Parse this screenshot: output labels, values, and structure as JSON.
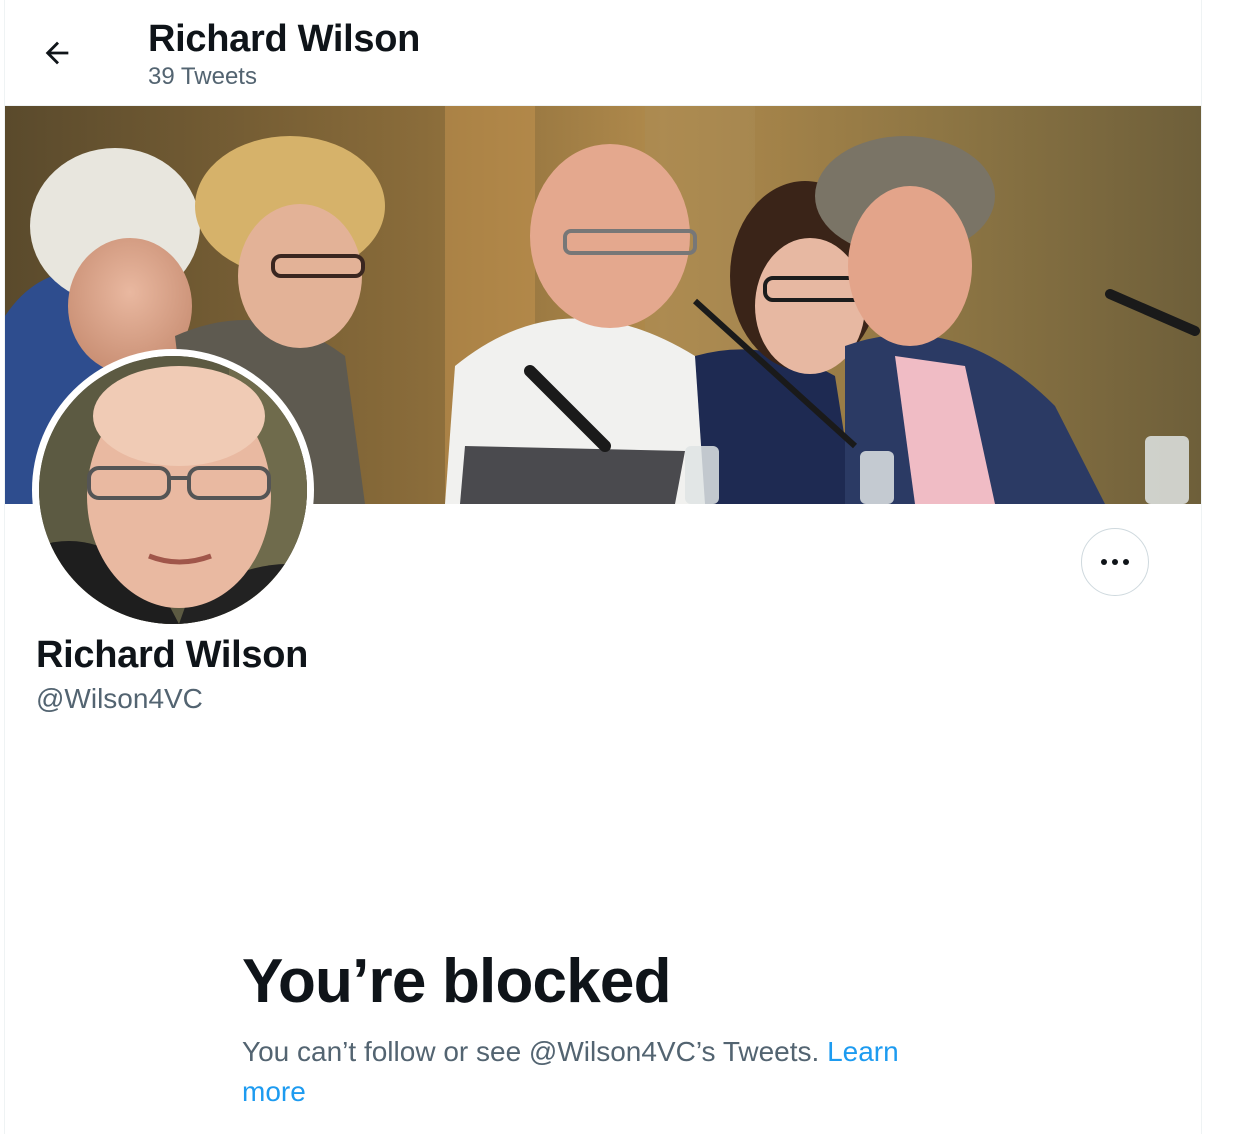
{
  "header": {
    "title": "Richard Wilson",
    "tweet_count": "39 Tweets"
  },
  "profile": {
    "name": "Richard Wilson",
    "handle": "@Wilson4VC"
  },
  "blocked": {
    "title": "You’re blocked",
    "message": "You can’t follow or see @Wilson4VC’s Tweets.",
    "link": "Learn more"
  },
  "icons": {
    "back": "arrow-left-icon",
    "more": "more-horizontal-icon"
  },
  "colors": {
    "link": "#1d9bf0",
    "secondary_text": "#536471",
    "primary_text": "#0f1419"
  }
}
